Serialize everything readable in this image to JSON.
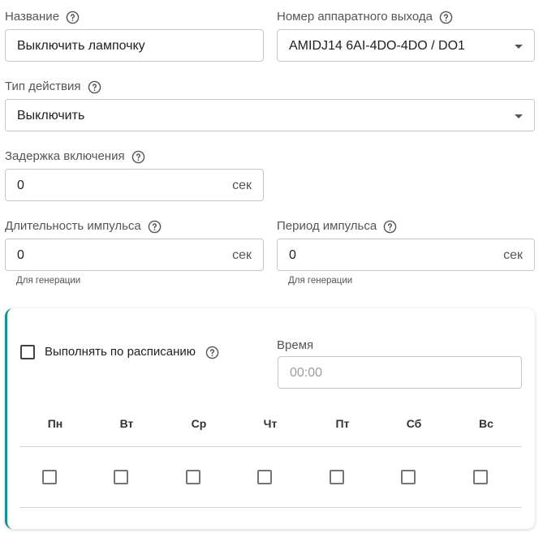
{
  "form": {
    "name": {
      "label": "Название",
      "value": "Выключить лампочку"
    },
    "output": {
      "label": "Номер аппаратного выхода",
      "value": "AMIDJ14 6AI-4DO-4DO / DO1"
    },
    "action_type": {
      "label": "Тип действия",
      "value": "Выключить"
    },
    "delay": {
      "label": "Задержка включения",
      "value": "0",
      "unit": "сек"
    },
    "pulse_duration": {
      "label": "Длительность импульса",
      "value": "0",
      "unit": "сек",
      "hint": "Для генерации"
    },
    "pulse_period": {
      "label": "Период импульса",
      "value": "0",
      "unit": "сек",
      "hint": "Для генерации"
    }
  },
  "schedule": {
    "checkbox_label": "Выполнять по расписанию",
    "checked": false,
    "time_label": "Время",
    "time_placeholder": "00:00",
    "days": [
      {
        "label": "Пн",
        "checked": false
      },
      {
        "label": "Вт",
        "checked": false
      },
      {
        "label": "Ср",
        "checked": false
      },
      {
        "label": "Чт",
        "checked": false
      },
      {
        "label": "Пт",
        "checked": false
      },
      {
        "label": "Сб",
        "checked": false
      },
      {
        "label": "Вс",
        "checked": false
      }
    ]
  },
  "icons": {
    "help": "help-circle-icon",
    "dropdown": "caret-down-icon"
  },
  "colors": {
    "accent": "#17918f",
    "border": "#c6c6c6",
    "label": "#555555"
  }
}
